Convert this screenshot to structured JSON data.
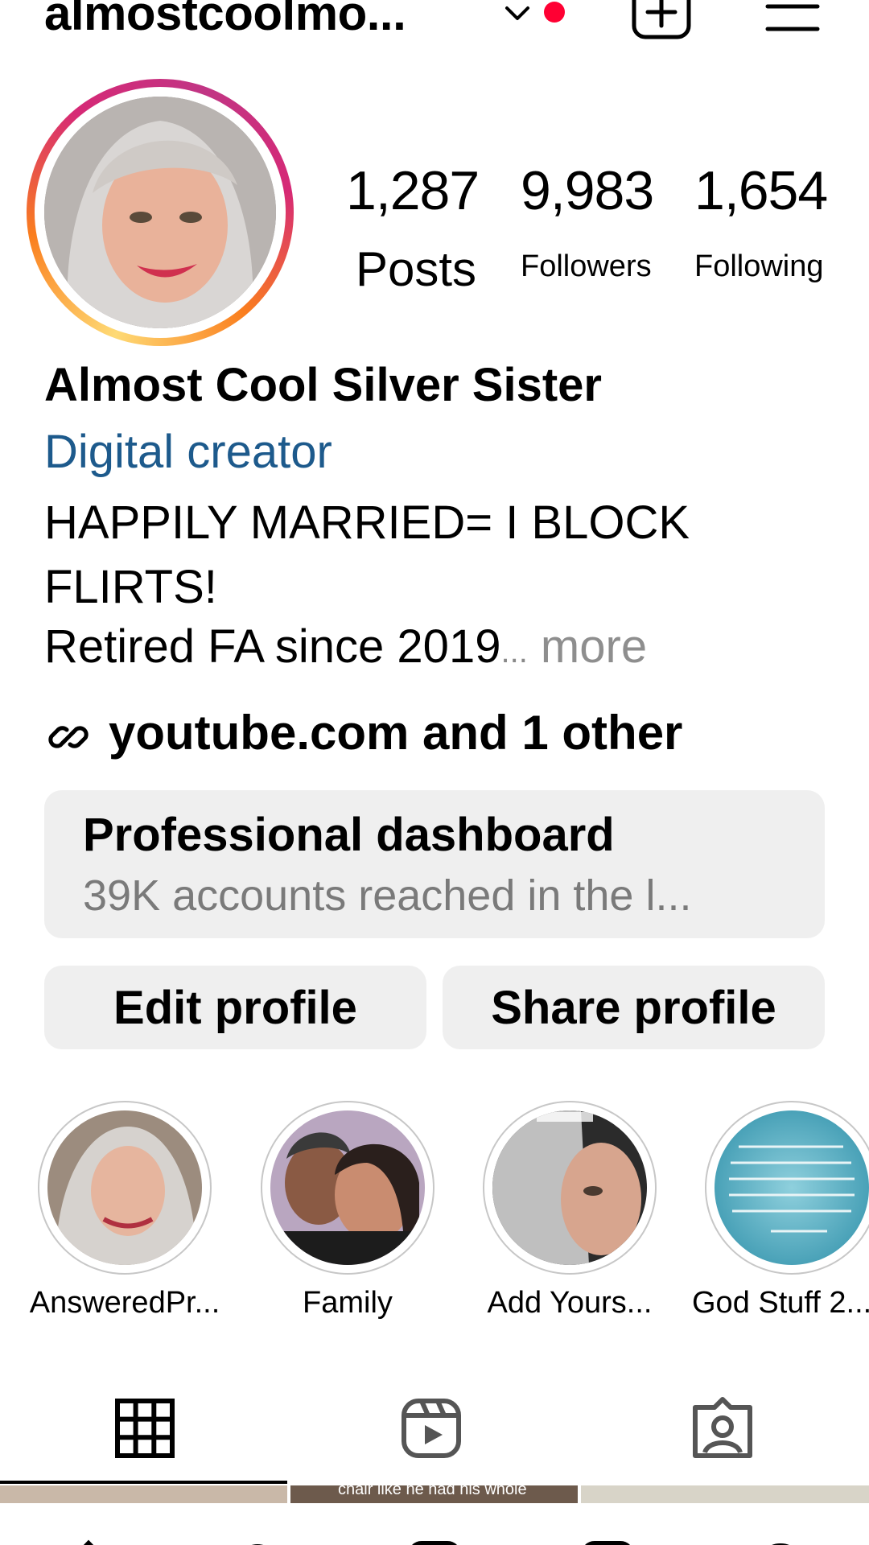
{
  "header": {
    "username": "almostcoolmo...",
    "icons": [
      "chevron-down-icon",
      "notification-dot",
      "create-post-icon",
      "menu-icon"
    ],
    "notification_color": "#ff0033"
  },
  "profile": {
    "stats": {
      "posts_count": "1,287",
      "posts_label": "Posts",
      "followers_count": "9,983",
      "followers_label": "Followers",
      "following_count": "1,654",
      "following_label": "Following"
    },
    "display_name": "Almost Cool Silver Sister",
    "category": "Digital creator",
    "bio_line1": "HAPPILY MARRIED= I BLOCK FLIRTS!",
    "bio_line2": "Retired FA since 2019",
    "bio_ellipsis": "...",
    "more_label": " more",
    "link_text": "youtube.com and 1 other",
    "category_color": "#1d5a8c"
  },
  "dashboard": {
    "title": "Professional dashboard",
    "subtitle": "39K accounts reached in the l..."
  },
  "buttons": {
    "edit_profile": "Edit profile",
    "share_profile": "Share profile"
  },
  "highlights": [
    {
      "label": "AnsweredPr..."
    },
    {
      "label": "Family"
    },
    {
      "label": "Add Yours..."
    },
    {
      "label": "God Stuff 2..."
    }
  ],
  "tabs": [
    "grid-icon",
    "reels-icon",
    "tagged-icon"
  ],
  "grid_preview_caption": "chair like he had his whole"
}
